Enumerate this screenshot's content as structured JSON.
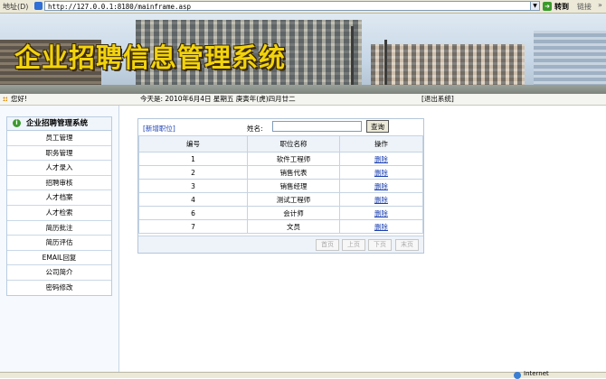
{
  "browser": {
    "address_label": "地址(D)",
    "url": "http://127.0.0.1:8180/mainframe.asp",
    "go_label": "转到",
    "links_label": "链接",
    "more_label": "»",
    "status_zone": "Internet"
  },
  "banner": {
    "title": "企业招聘信息管理系统"
  },
  "infobar": {
    "greeting": "您好!",
    "today": "今天是: 2010年6月4日 星期五 庚寅年(虎)四月廿二",
    "logout": "[退出系统]"
  },
  "menu": {
    "title": "企业招聘管理系统",
    "items": [
      "员工管理",
      "职务管理",
      "人才录入",
      "招聘审核",
      "人才档案",
      "人才检索",
      "简历批注",
      "简历评估",
      "EMAIL回复",
      "公司简介",
      "密码修改"
    ]
  },
  "main": {
    "add_link": "[新增职位]",
    "name_label": "姓名:",
    "name_value": "",
    "search_button": "查询",
    "columns": [
      "编号",
      "职位名称",
      "操作"
    ],
    "rows": [
      {
        "id": "1",
        "name": "软件工程师",
        "action": "删除"
      },
      {
        "id": "2",
        "name": "销售代表",
        "action": "删除"
      },
      {
        "id": "3",
        "name": "销售经理",
        "action": "删除"
      },
      {
        "id": "4",
        "name": "测试工程师",
        "action": "删除"
      },
      {
        "id": "6",
        "name": "会计师",
        "action": "删除"
      },
      {
        "id": "7",
        "name": "文员",
        "action": "删除"
      }
    ],
    "pager": {
      "first": "首页",
      "prev": "上页",
      "next": "下页",
      "last": "末页"
    }
  }
}
